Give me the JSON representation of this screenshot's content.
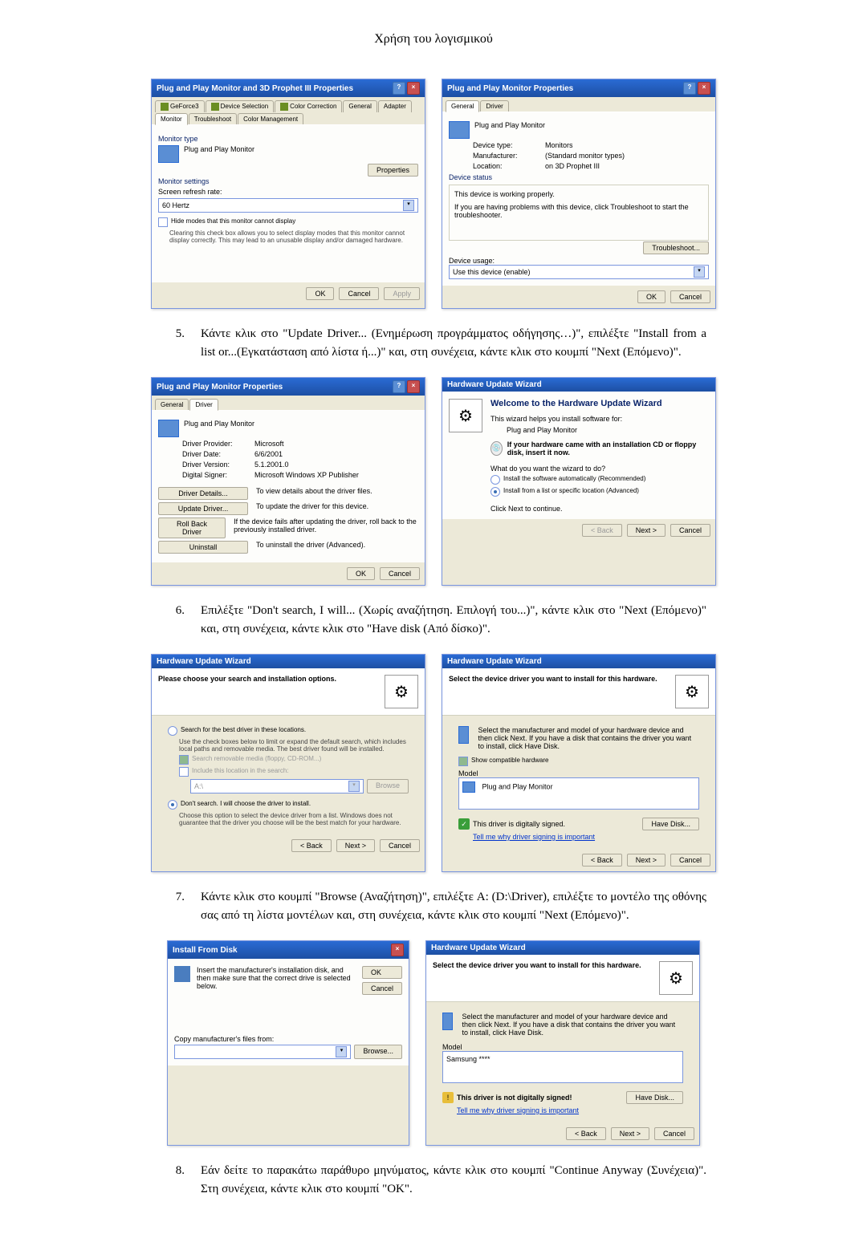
{
  "page": {
    "title": "Χρήση του λογισμικού"
  },
  "steps": {
    "s5": {
      "num": "5.",
      "text": "Κάντε κλικ στο \"Update Driver... (Ενημέρωση προγράμματος οδήγησης…)\", επιλέξτε \"Install from a list or...(Εγκατάσταση από λίστα ή...)\" και, στη συνέχεια, κάντε κλικ στο κουμπί \"Next (Επόμενο)\"."
    },
    "s6": {
      "num": "6.",
      "text": "Επιλέξτε \"Don't search, I will... (Χωρίς αναζήτηση. Επιλογή του...)\", κάντε κλικ στο \"Next (Επόμενο)\" και, στη συνέχεια, κάντε κλικ στο \"Have disk (Από δίσκο)\"."
    },
    "s7": {
      "num": "7.",
      "text": "Κάντε κλικ στο κουμπί \"Browse (Αναζήτηση)\", επιλέξτε A: (D:\\Driver), επιλέξτε το μοντέλο της οθόνης σας από τη λίστα μοντέλων και, στη συνέχεια, κάντε κλικ στο κουμπί \"Next (Επόμενο)\"."
    },
    "s8": {
      "num": "8.",
      "text": "Εάν δείτε το παρακάτω παράθυρο μηνύματος, κάντε κλικ στο κουμπί \"Continue Anyway (Συνέχεια)\". Στη συνέχεια, κάντε κλικ στο κουμπί \"OK\"."
    }
  },
  "dlg1a": {
    "title": "Plug and Play Monitor and 3D Prophet III Properties",
    "tabs": {
      "geforce": "GeForce3",
      "device_sel": "Device Selection",
      "color_corr": "Color Correction",
      "general": "General",
      "adapter": "Adapter",
      "monitor": "Monitor",
      "troubleshoot": "Troubleshoot",
      "color_mgmt": "Color Management"
    },
    "monitor_type_label": "Monitor type",
    "monitor_name": "Plug and Play Monitor",
    "properties_btn": "Properties",
    "monitor_settings_label": "Monitor settings",
    "refresh_label": "Screen refresh rate:",
    "refresh_value": "60 Hertz",
    "hide_modes": "Hide modes that this monitor cannot display",
    "hide_modes_desc": "Clearing this check box allows you to select display modes that this monitor cannot display correctly. This may lead to an unusable display and/or damaged hardware.",
    "ok": "OK",
    "cancel": "Cancel",
    "apply": "Apply"
  },
  "dlg1b": {
    "title": "Plug and Play Monitor Properties",
    "tabs": {
      "general": "General",
      "driver": "Driver"
    },
    "name": "Plug and Play Monitor",
    "device_type_label": "Device type:",
    "device_type": "Monitors",
    "manufacturer_label": "Manufacturer:",
    "manufacturer": "(Standard monitor types)",
    "location_label": "Location:",
    "location": "on 3D Prophet III",
    "device_status_label": "Device status",
    "device_status": "This device is working properly.",
    "device_status_help": "If you are having problems with this device, click Troubleshoot to start the troubleshooter.",
    "troubleshoot_btn": "Troubleshoot...",
    "device_usage_label": "Device usage:",
    "device_usage": "Use this device (enable)",
    "ok": "OK",
    "cancel": "Cancel"
  },
  "dlg2a": {
    "title": "Plug and Play Monitor Properties",
    "tabs": {
      "general": "General",
      "driver": "Driver"
    },
    "name": "Plug and Play Monitor",
    "provider_label": "Driver Provider:",
    "provider": "Microsoft",
    "date_label": "Driver Date:",
    "date": "6/6/2001",
    "version_label": "Driver Version:",
    "version": "5.1.2001.0",
    "signer_label": "Digital Signer:",
    "signer": "Microsoft Windows XP Publisher",
    "details_btn": "Driver Details...",
    "details_desc": "To view details about the driver files.",
    "update_btn": "Update Driver...",
    "update_desc": "To update the driver for this device.",
    "rollback_btn": "Roll Back Driver",
    "rollback_desc": "If the device fails after updating the driver, roll back to the previously installed driver.",
    "uninstall_btn": "Uninstall",
    "uninstall_desc": "To uninstall the driver (Advanced).",
    "ok": "OK",
    "cancel": "Cancel"
  },
  "dlg2b": {
    "title": "Hardware Update Wizard",
    "welcome": "Welcome to the Hardware Update Wizard",
    "intro": "This wizard helps you install software for:",
    "device": "Plug and Play Monitor",
    "cd_note": "If your hardware came with an installation CD or floppy disk, insert it now.",
    "question": "What do you want the wizard to do?",
    "opt1": "Install the software automatically (Recommended)",
    "opt2": "Install from a list or specific location (Advanced)",
    "continue": "Click Next to continue.",
    "back": "< Back",
    "next": "Next >",
    "cancel": "Cancel"
  },
  "dlg3a": {
    "title": "Hardware Update Wizard",
    "header": "Please choose your search and installation options.",
    "opt1": "Search for the best driver in these locations.",
    "opt1_desc": "Use the check boxes below to limit or expand the default search, which includes local paths and removable media. The best driver found will be installed.",
    "chk1": "Search removable media (floppy, CD-ROM...)",
    "chk2": "Include this location in the search:",
    "path": "A:\\",
    "browse": "Browse",
    "opt2": "Don't search. I will choose the driver to install.",
    "opt2_desc": "Choose this option to select the device driver from a list. Windows does not guarantee that the driver you choose will be the best match for your hardware.",
    "back": "< Back",
    "next": "Next >",
    "cancel": "Cancel"
  },
  "dlg3b": {
    "title": "Hardware Update Wizard",
    "header": "Select the device driver you want to install for this hardware.",
    "instruction": "Select the manufacturer and model of your hardware device and then click Next. If you have a disk that contains the driver you want to install, click Have Disk.",
    "show_compat": "Show compatible hardware",
    "model_label": "Model",
    "model_item": "Plug and Play Monitor",
    "signed_note": "This driver is digitally signed.",
    "signing_link": "Tell me why driver signing is important",
    "have_disk": "Have Disk...",
    "back": "< Back",
    "next": "Next >",
    "cancel": "Cancel"
  },
  "dlg4a": {
    "title": "Install From Disk",
    "instruction": "Insert the manufacturer's installation disk, and then make sure that the correct drive is selected below.",
    "ok": "OK",
    "cancel": "Cancel",
    "copy_label": "Copy manufacturer's files from:",
    "browse": "Browse..."
  },
  "dlg4b": {
    "title": "Hardware Update Wizard",
    "header": "Select the device driver you want to install for this hardware.",
    "instruction": "Select the manufacturer and model of your hardware device and then click Next. If you have a disk that contains the driver you want to install, click Have Disk.",
    "model_label": "Model",
    "model_item": "Samsung ****",
    "unsigned_note": "This driver is not digitally signed!",
    "signing_link": "Tell me why driver signing is important",
    "have_disk": "Have Disk...",
    "back": "< Back",
    "next": "Next >",
    "cancel": "Cancel"
  }
}
